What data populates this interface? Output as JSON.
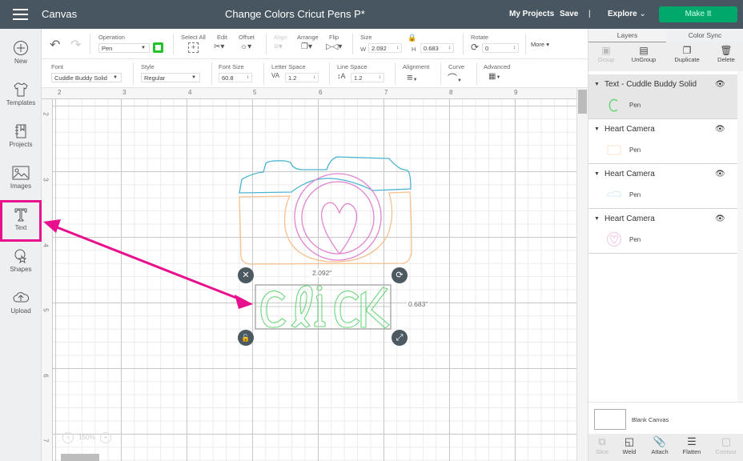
{
  "topbar": {
    "menu_icon": "hamburger-icon",
    "app_name": "Canvas",
    "project_title": "Change Colors Cricut Pens P*",
    "my_projects": "My Projects",
    "save": "Save",
    "divider": "|",
    "explore": "Explore",
    "make_it": "Make It",
    "accent_color": "#00a96b"
  },
  "sidebar": {
    "items": [
      {
        "label": "New",
        "icon": "plus-circle-icon"
      },
      {
        "label": "Templates",
        "icon": "tshirt-icon"
      },
      {
        "label": "Projects",
        "icon": "notebook-icon"
      },
      {
        "label": "Images",
        "icon": "image-icon"
      },
      {
        "label": "Text",
        "icon": "text-t-icon",
        "highlighted": true
      },
      {
        "label": "Shapes",
        "icon": "shapes-icon"
      },
      {
        "label": "Upload",
        "icon": "cloud-upload-icon"
      }
    ],
    "highlight_color": "#e8118d"
  },
  "toolbar": {
    "operation_label": "Operation",
    "operation_value": "Pen",
    "pen_color": "#22c22a",
    "select_all": "Select All",
    "edit": "Edit",
    "offset": "Offset",
    "align": "Align",
    "arrange": "Arrange",
    "flip": "Flip",
    "size_label": "Size",
    "w_label": "W",
    "w_value": "2.092",
    "h_label": "H",
    "h_value": "0.683",
    "rotate_label": "Rotate",
    "rotate_value": "0",
    "more": "More"
  },
  "text_toolbar": {
    "font_label": "Font",
    "font_value": "Cuddle Buddy Solid",
    "style_label": "Style",
    "style_value": "Regular",
    "font_size_label": "Font Size",
    "font_size_value": "60.8",
    "letter_space_label": "Letter Space",
    "letter_space_value": "1.2",
    "line_space_label": "Line Space",
    "line_space_value": "1.2",
    "alignment_label": "Alignment",
    "curve_label": "Curve",
    "advanced_label": "Advanced"
  },
  "rulers": {
    "top": [
      "2",
      "3",
      "4",
      "5",
      "6",
      "7",
      "8",
      "9"
    ],
    "left": [
      "2",
      "3",
      "4",
      "5",
      "6",
      "7"
    ]
  },
  "canvas": {
    "selected_text": "Click",
    "width_readout": "2.092\"",
    "height_readout": "0.683\"",
    "zoom": "150%"
  },
  "layers_panel": {
    "tabs": [
      "Layers",
      "Color Sync"
    ],
    "actions": [
      {
        "label": "Group",
        "icon": "group-icon",
        "disabled": true
      },
      {
        "label": "UnGroup",
        "icon": "ungroup-icon",
        "disabled": false
      },
      {
        "label": "Duplicate",
        "icon": "duplicate-icon",
        "disabled": false
      },
      {
        "label": "Delete",
        "icon": "trash-icon",
        "disabled": false
      }
    ],
    "layers": [
      {
        "name": "Text - Cuddle Buddy Solid",
        "sub": "Pen",
        "selected": true
      },
      {
        "name": "Heart Camera",
        "sub": "Pen",
        "selected": false
      },
      {
        "name": "Heart Camera",
        "sub": "Pen",
        "selected": false
      },
      {
        "name": "Heart Camera",
        "sub": "Pen",
        "selected": false
      }
    ],
    "blank_canvas": "Blank Canvas",
    "bottom_actions": [
      {
        "label": "Slice",
        "icon": "slice-icon",
        "disabled": true
      },
      {
        "label": "Weld",
        "icon": "weld-icon",
        "disabled": false
      },
      {
        "label": "Attach",
        "icon": "paperclip-icon",
        "disabled": false
      },
      {
        "label": "Flatten",
        "icon": "flatten-icon",
        "disabled": false
      },
      {
        "label": "Contour",
        "icon": "contour-icon",
        "disabled": true
      }
    ]
  }
}
